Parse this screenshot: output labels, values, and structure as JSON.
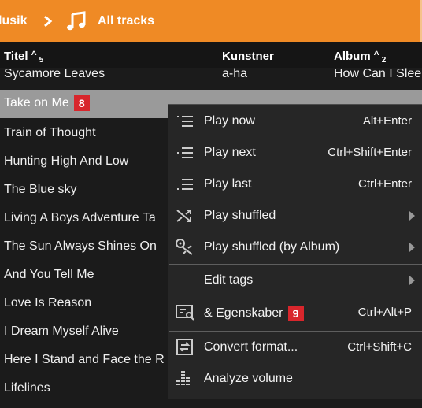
{
  "breadcrumb": {
    "root": "lusik",
    "current": "All tracks",
    "icon": "music-note-icon"
  },
  "columns": {
    "title": "Titel",
    "title_sort_caret": "^",
    "title_sort_index": "5",
    "artist": "Kunstner",
    "album": "Album",
    "album_sort_caret": "^",
    "album_sort_index": "2"
  },
  "tracks": [
    {
      "title": "Sycamore Leaves",
      "artist": "a-ha",
      "album": "How Can I Slee"
    },
    {
      "title": "Take on Me",
      "badge": "8"
    },
    {
      "title": "Train of Thought"
    },
    {
      "title": "Hunting High And Low"
    },
    {
      "title": "The Blue sky"
    },
    {
      "title": "Living A Boys Adventure Ta"
    },
    {
      "title": "The Sun Always Shines On"
    },
    {
      "title": "And You Tell Me"
    },
    {
      "title": "Love Is Reason"
    },
    {
      "title": "I Dream Myself Alive"
    },
    {
      "title": "Here I Stand and Face the R"
    },
    {
      "title": "Lifelines"
    }
  ],
  "context_menu": {
    "items": [
      {
        "label": "Play now",
        "shortcut": "Alt+Enter",
        "icon": "play-now-icon"
      },
      {
        "label": "Play next",
        "shortcut": "Ctrl+Shift+Enter",
        "icon": "play-next-icon"
      },
      {
        "label": "Play last",
        "shortcut": "Ctrl+Enter",
        "icon": "play-last-icon"
      },
      {
        "label": "Play shuffled",
        "icon": "shuffle-icon",
        "submenu": true
      },
      {
        "label": "Play shuffled (by Album)",
        "icon": "shuffle-album-icon",
        "submenu": true
      },
      {
        "label": "Edit tags",
        "submenu": true
      },
      {
        "label": "& Egenskaber",
        "badge": "9",
        "shortcut": "Ctrl+Alt+P",
        "icon": "properties-icon"
      },
      {
        "label": "Convert format...",
        "shortcut": "Ctrl+Shift+C",
        "icon": "convert-icon"
      },
      {
        "label": "Analyze volume",
        "icon": "analyze-volume-icon"
      }
    ]
  },
  "colors": {
    "accent": "#ef8a25",
    "badge": "#d8262c",
    "selected_row": "#9a9a9a",
    "background": "#1b1b1b",
    "menu_background": "#262626"
  }
}
